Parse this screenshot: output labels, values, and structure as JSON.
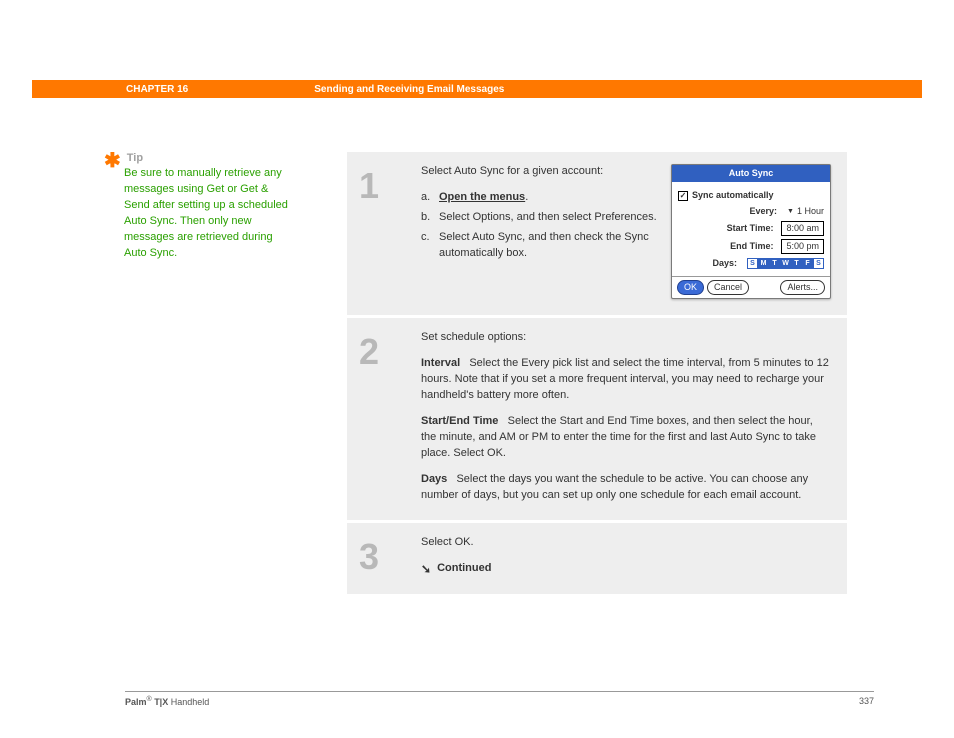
{
  "header": {
    "chapter": "CHAPTER 16",
    "title": "Sending and Receiving Email Messages"
  },
  "tip": {
    "heading": "Tip",
    "body": "Be sure to manually retrieve any messages using Get or Get & Send after setting up a scheduled Auto Sync. Then only new messages are retrieved during Auto Sync."
  },
  "steps": {
    "s1": {
      "num": "1",
      "intro": "Select Auto Sync for a given account:",
      "a_letter": "a.",
      "a_text": "Open the menus",
      "a_dot": ".",
      "b_letter": "b.",
      "b_text": "Select Options, and then select Preferences.",
      "c_letter": "c.",
      "c_text": "Select Auto Sync, and then check the Sync automatically box."
    },
    "s2": {
      "num": "2",
      "intro": "Set schedule options:",
      "interval_label": "Interval",
      "interval_text": "Select the Every pick list and select the time interval, from 5 minutes to 12 hours. Note that if you set a more frequent interval, you may need to recharge your handheld's battery more often.",
      "startend_label": "Start/End Time",
      "startend_text": "Select the Start and End Time boxes, and then select the hour, the minute, and AM or PM to enter the time for the first and last Auto Sync to take place. Select OK.",
      "days_label": "Days",
      "days_text": "Select the days you want the schedule to be active. You can choose any number of days, but you can set up only one schedule for each email account."
    },
    "s3": {
      "num": "3",
      "text": "Select OK.",
      "continued": "Continued"
    }
  },
  "palm": {
    "title": "Auto Sync",
    "sync_auto": "Sync automatically",
    "every_label": "Every:",
    "every_value": "1 Hour",
    "start_label": "Start Time:",
    "start_value": "8:00 am",
    "end_label": "End Time:",
    "end_value": "5:00 pm",
    "days_label": "Days:",
    "days": [
      "S",
      "M",
      "T",
      "W",
      "T",
      "F",
      "S"
    ],
    "ok": "OK",
    "cancel": "Cancel",
    "alerts": "Alerts..."
  },
  "footer": {
    "brand_bold": "Palm",
    "reg": "®",
    "model": " T|X ",
    "suffix": "Handheld",
    "page": "337"
  }
}
